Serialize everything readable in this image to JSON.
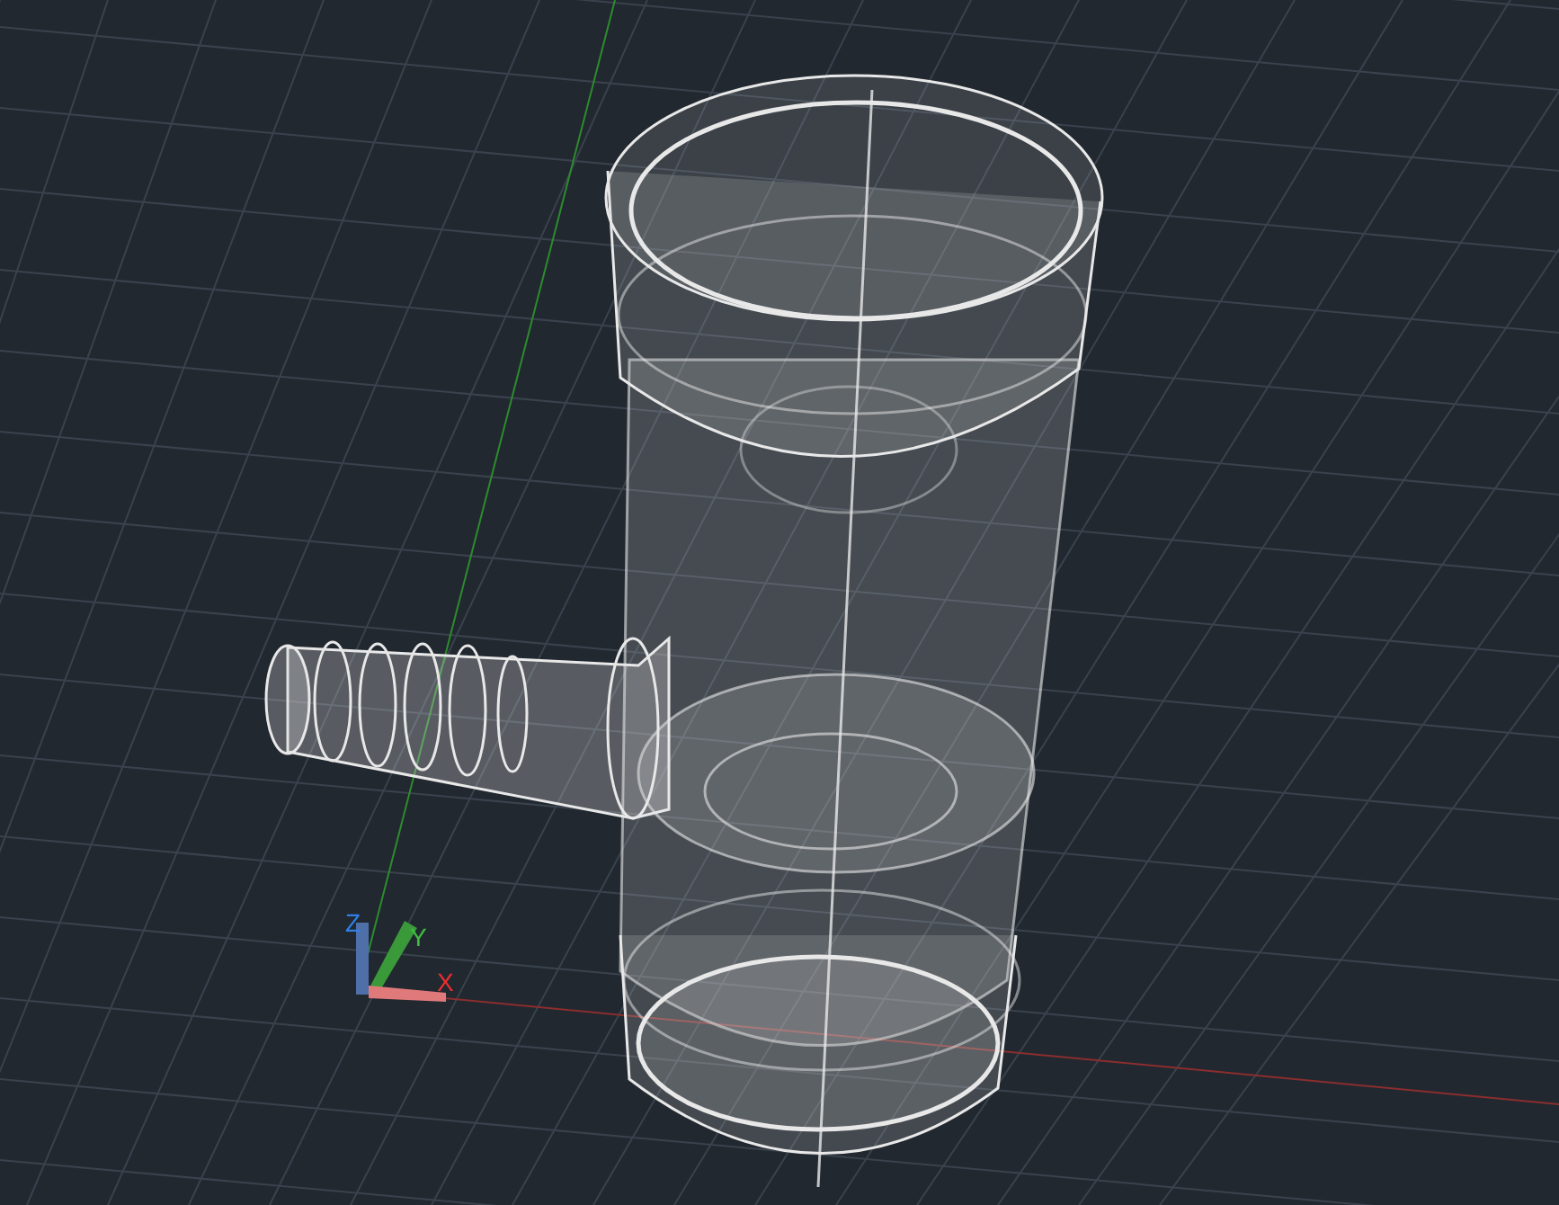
{
  "viewport": {
    "ucs_axes": [
      {
        "label": "Z",
        "color": "#2f7fe8"
      },
      {
        "label": "Y",
        "color": "#3fbf3f"
      },
      {
        "label": "X",
        "color": "#e83030"
      }
    ]
  }
}
